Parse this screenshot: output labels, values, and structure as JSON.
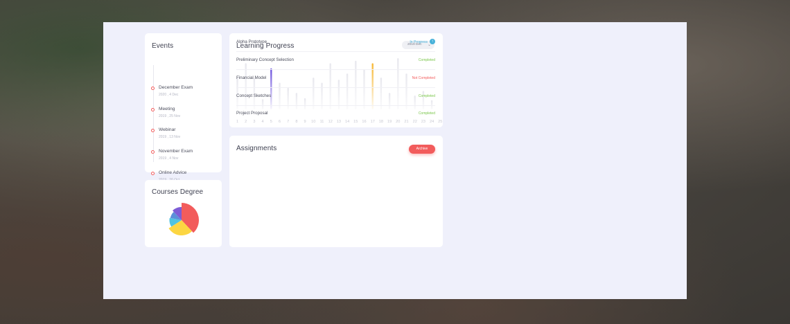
{
  "events": {
    "title": "Events",
    "items": [
      {
        "name": "December Exam",
        "date": "2020 , 4 Dec"
      },
      {
        "name": "Meeting",
        "date": "2019 , 25 Nov"
      },
      {
        "name": "Webinar",
        "date": "2019 , 13 Nov"
      },
      {
        "name": "November Exam",
        "date": "2019 , 4 Nov"
      },
      {
        "name": "Online Advice",
        "date": "2019 , 26 Oct"
      }
    ]
  },
  "courses": {
    "title": "Courses Degree",
    "slices": [
      {
        "color": "#f25c5c",
        "value": 38
      },
      {
        "color": "#fcd642",
        "value": 28
      },
      {
        "color": "#4fc3e0",
        "value": 12
      },
      {
        "color": "#5b8fd9",
        "value": 10
      },
      {
        "color": "#7d5cd6",
        "value": 12
      }
    ]
  },
  "progress": {
    "title": "Learning Progress",
    "date_select": "2019 Dec",
    "chevron_icon": "chevron-down-icon",
    "bar_color": "#e8e8ee",
    "highlight_colors": {
      "5": "#6a4fdc",
      "17": "#f7b733"
    },
    "chart_data": {
      "type": "bar",
      "categories": [
        "1",
        "2",
        "3",
        "4",
        "5",
        "6",
        "7",
        "8",
        "9",
        "10",
        "11",
        "12",
        "13",
        "14",
        "15",
        "16",
        "17",
        "18",
        "19",
        "20",
        "21",
        "22",
        "23",
        "24",
        "25",
        "26",
        "27",
        "28",
        "29"
      ],
      "values": [
        62,
        90,
        62,
        20,
        80,
        52,
        42,
        32,
        22,
        62,
        52,
        90,
        58,
        70,
        95,
        78,
        90,
        62,
        32,
        100,
        70,
        27,
        36,
        18,
        0,
        0,
        0,
        0,
        0
      ],
      "ylim": [
        0,
        100
      ]
    }
  },
  "assignments": {
    "title": "Assignments",
    "archive_label": "Archive",
    "status_colors": {
      "In Progress": "#47b1d9",
      "Completed": "#7ac64a",
      "Not Completed": "#f25c5c"
    },
    "rows": [
      {
        "name": "Alpha Prototype",
        "status": "In Progress"
      },
      {
        "name": "Preliminary Concept Selection",
        "status": "Completed"
      },
      {
        "name": "Financial Model",
        "status": "Not Completed"
      },
      {
        "name": "Concept Sketches",
        "status": "Completed"
      },
      {
        "name": "Project Proposal",
        "status": "Completed"
      }
    ],
    "in_progress_icon": "arrow-up-icon",
    "in_progress_glyph": "↑"
  }
}
